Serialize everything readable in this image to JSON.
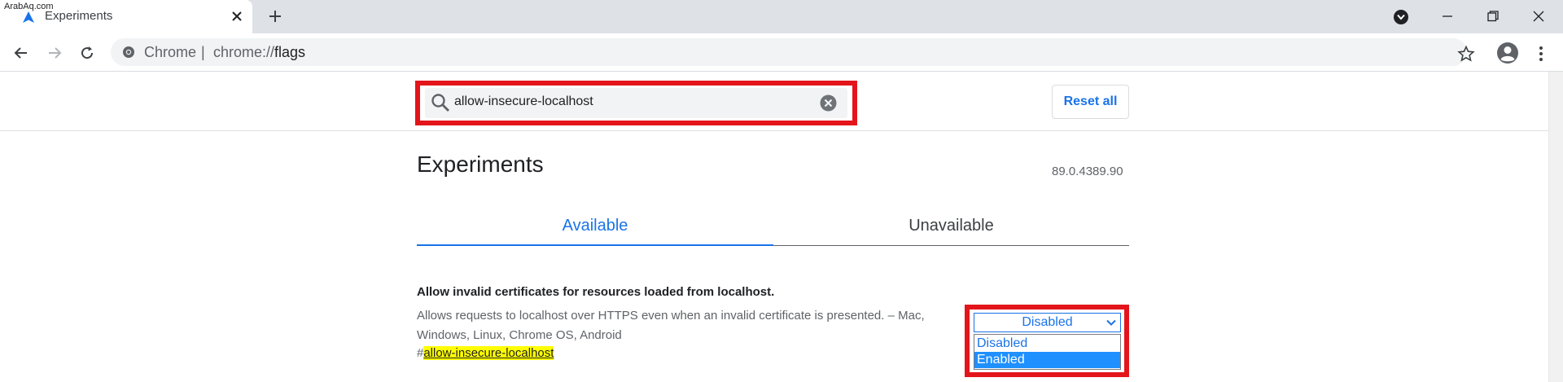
{
  "watermark": "ArabAq.com",
  "tab": {
    "title": "Experiments",
    "close_glyph": "✕"
  },
  "omnibox": {
    "site_label": "Chrome",
    "separator": "|",
    "url_scheme": "chrome://",
    "url_host": "flags"
  },
  "search": {
    "value": "allow-insecure-localhost"
  },
  "header": {
    "reset_label": "Reset all"
  },
  "page": {
    "title": "Experiments",
    "version": "89.0.4389.90"
  },
  "tabs": [
    {
      "label": "Available",
      "active": true
    },
    {
      "label": "Unavailable",
      "active": false
    }
  ],
  "experiment": {
    "title": "Allow invalid certificates for resources loaded from localhost.",
    "description": "Allows requests to localhost over HTTPS even when an invalid certificate is presented. – Mac, Windows, Linux, Chrome OS, Android",
    "link_hash": "#",
    "link_name": "allow-insecure-localhost",
    "selected": "Disabled",
    "options": [
      "Disabled",
      "Enabled"
    ],
    "highlighted_option": "Enabled"
  },
  "colors": {
    "accent": "#1a73e8",
    "highlight_box": "#e3151b",
    "search_highlight": "#ffff00",
    "option_hover": "#1e90ff"
  },
  "icons": [
    "chrome-flags-favicon",
    "close-icon",
    "plus-icon",
    "tab-search-icon",
    "minimize-icon",
    "restore-icon",
    "window-close-icon",
    "back-arrow-icon",
    "forward-arrow-icon",
    "reload-icon",
    "chrome-logo-icon",
    "star-icon",
    "profile-avatar-icon",
    "kebab-menu-icon",
    "search-icon",
    "clear-icon",
    "chevron-down-icon"
  ]
}
